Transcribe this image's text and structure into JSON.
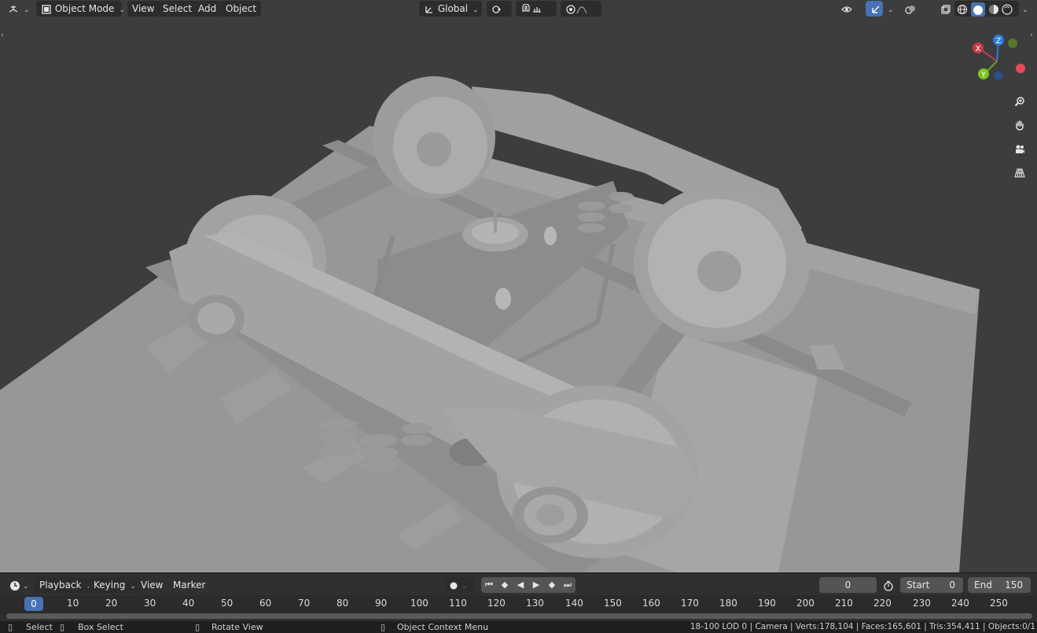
{
  "header": {
    "mode_label": "Object Mode",
    "menus": [
      "View",
      "Select",
      "Add",
      "Object"
    ],
    "orientation_label": "Global"
  },
  "gizmo": {
    "x_label": "X",
    "y_label": "Y",
    "z_label": "Z"
  },
  "timeline": {
    "playback_label": "Playback",
    "keying_label": "Keying",
    "view_label": "View",
    "marker_label": "Marker",
    "current_frame": "0",
    "start_label": "Start",
    "start_value": "0",
    "end_label": "End",
    "end_value": "150",
    "ticks": [
      "10",
      "20",
      "30",
      "40",
      "50",
      "60",
      "70",
      "80",
      "90",
      "100",
      "110",
      "120",
      "130",
      "140",
      "150",
      "160",
      "170",
      "180",
      "190",
      "200",
      "210",
      "220",
      "230",
      "240",
      "250"
    ],
    "marker_frame": "0"
  },
  "status": {
    "select": "Select",
    "box_select": "Box Select",
    "rotate_view": "Rotate View",
    "context_menu": "Object Context Menu",
    "stats": "18-100 LOD 0 | Camera | Verts:178,104 | Faces:165,601 | Tris:354,411 | Objects:0/1"
  },
  "colors": {
    "accent": "#4772b3",
    "viewport_bg": "#3d3d3d",
    "model": "#a9a9a9"
  }
}
